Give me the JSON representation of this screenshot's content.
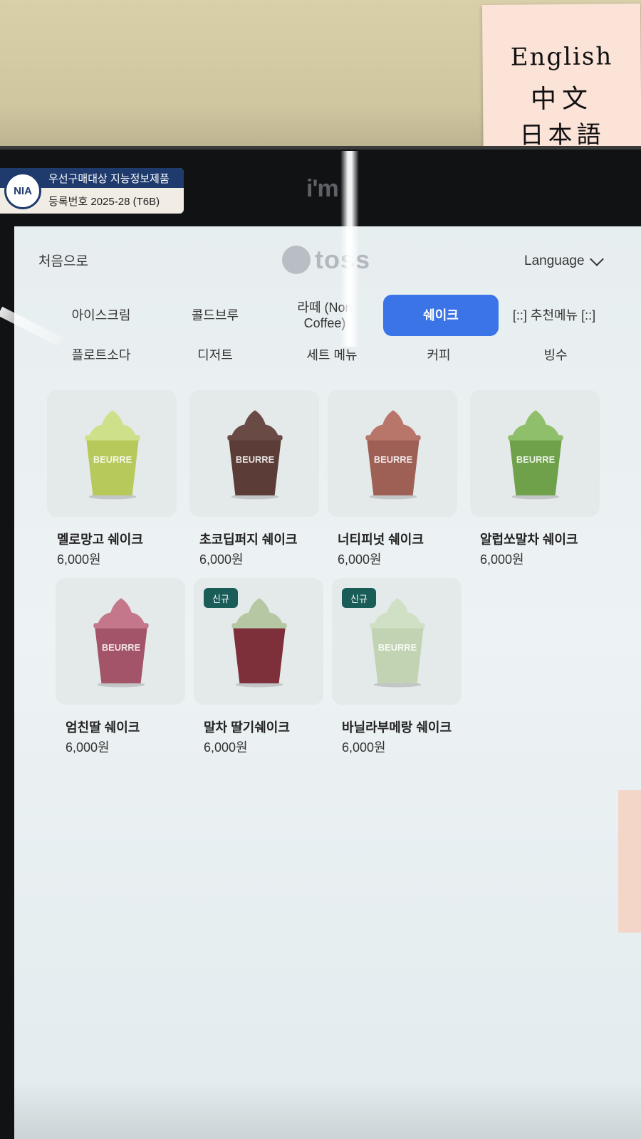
{
  "sticker": {
    "badge": "NIA",
    "line1": "우선구매대상 지능정보제품",
    "line2": "등록번호 2025-28 (T6B)"
  },
  "device_logo": "i'm",
  "note": {
    "line1": "English",
    "line2": "中文",
    "line3": "日本語",
    "arrow_color": "#e53a2e"
  },
  "header": {
    "home": "처음으로",
    "logo_text": "toss",
    "language": "Language",
    "language_icon": "chevron-down-icon"
  },
  "categories": [
    {
      "label": "아이스크림",
      "active": false
    },
    {
      "label": "콜드브루",
      "active": false
    },
    {
      "label": "라떼 (Non Coffee)",
      "active": false
    },
    {
      "label": "쉐이크",
      "active": true
    },
    {
      "label": "[::] 추천메뉴 [::]",
      "active": false
    },
    {
      "label": "플로트소다",
      "active": false
    },
    {
      "label": "디저트",
      "active": false
    },
    {
      "label": "세트 메뉴",
      "active": false
    },
    {
      "label": "커피",
      "active": false
    },
    {
      "label": "빙수",
      "active": false
    }
  ],
  "products": [
    {
      "name": "멜로망고 쉐이크",
      "price": "6,000원",
      "badge": "",
      "top_color": "#cfe08a",
      "body_color": "#b6c95a",
      "cup_text": "BEURRE"
    },
    {
      "name": "초코딥퍼지 쉐이크",
      "price": "6,000원",
      "badge": "",
      "top_color": "#6a4a44",
      "body_color": "#5b3c36",
      "cup_text": "BEURRE"
    },
    {
      "name": "너티피넛 쉐이크",
      "price": "6,000원",
      "badge": "",
      "top_color": "#b8766a",
      "body_color": "#9e5f55",
      "cup_text": "BEURRE"
    },
    {
      "name": "알럽쏘말차 쉐이크",
      "price": "6,000원",
      "badge": "",
      "top_color": "#8fbf6a",
      "body_color": "#6fa04a",
      "cup_text": "BEURRE"
    },
    {
      "name": "엄친딸 쉐이크",
      "price": "6,000원",
      "badge": "",
      "top_color": "#c4778a",
      "body_color": "#a35468",
      "cup_text": "BEURRE"
    },
    {
      "name": "말차 딸기쉐이크",
      "price": "6,000원",
      "badge": "신규",
      "top_color": "#b5c7a3",
      "body_color": "#7d2f3a",
      "cup_text": ""
    },
    {
      "name": "바닐라부메랑 쉐이크",
      "price": "6,000원",
      "badge": "신규",
      "top_color": "#cfe0c5",
      "body_color": "#c2d3b3",
      "cup_text": "BEURRE"
    }
  ],
  "accent": "#3a74e6",
  "badge_color": "#1a5d58"
}
